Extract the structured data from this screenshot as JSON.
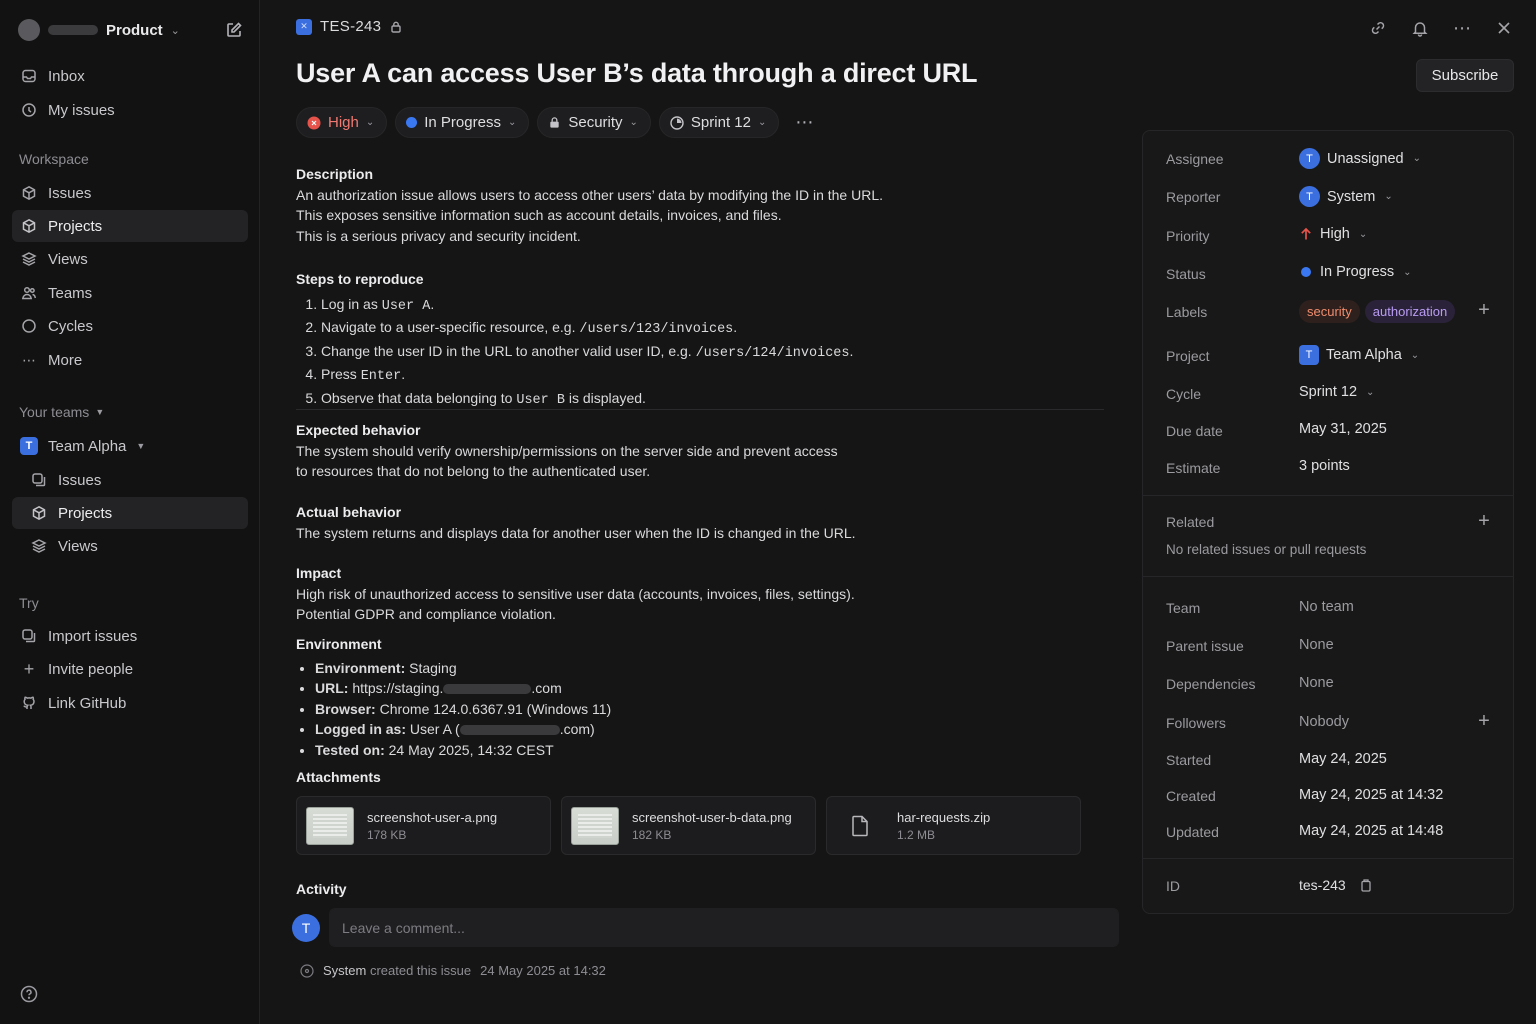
{
  "sidebar": {
    "workspace_name": "Product",
    "nav": [
      {
        "label": "Inbox"
      },
      {
        "label": "My issues"
      }
    ],
    "workspace_label": "Workspace",
    "workspace_items": [
      {
        "label": "Issues"
      },
      {
        "label": "Projects"
      },
      {
        "label": "Views"
      },
      {
        "label": "Teams"
      },
      {
        "label": "Cycles"
      },
      {
        "label": "More"
      }
    ],
    "your_teams_label": "Your teams",
    "team": {
      "badge": "T",
      "name": "Team Alpha"
    },
    "team_items": [
      {
        "label": "Issues"
      },
      {
        "label": "Projects"
      },
      {
        "label": "Views"
      }
    ],
    "try_label": "Try",
    "try_items": [
      {
        "label": "Import issues"
      },
      {
        "label": "Invite people"
      },
      {
        "label": "Link GitHub"
      }
    ]
  },
  "issue": {
    "id": "TES-243",
    "title": "User A can access User B’s data through a direct URL",
    "subscribe_label": "Subscribe",
    "pills": {
      "priority": "High",
      "status": "In Progress",
      "label": "Security",
      "sprint": "Sprint 12"
    },
    "description": {
      "heading": "Description",
      "lines": [
        "An authorization issue allows users to access other users’ data by modifying the ID in the URL.",
        "This exposes sensitive information such as account details, invoices, and files.",
        "This is a serious privacy and security incident."
      ]
    },
    "steps": {
      "heading": "Steps to reproduce",
      "items": [
        {
          "pre": "Log in as ",
          "code": "User A",
          "post": "."
        },
        {
          "pre": "Navigate to a user-specific resource, e.g. ",
          "code": "/users/123/invoices",
          "post": "."
        },
        {
          "pre": "Change the user ID in the URL to another valid user ID, e.g. ",
          "code": "/users/124/invoices",
          "post": "."
        },
        {
          "pre": "Press ",
          "code": "Enter",
          "post": "."
        },
        {
          "pre": "Observe that data belonging to ",
          "code": "User B",
          "post": " is displayed."
        }
      ]
    },
    "expected": {
      "heading": "Expected behavior",
      "lines": [
        "The system should verify ownership/permissions on the server side and prevent access",
        "to resources that do not belong to the authenticated user."
      ]
    },
    "actual": {
      "heading": "Actual behavior",
      "lines": [
        "The system returns and displays data for another user when the ID is changed in the URL."
      ]
    },
    "impact": {
      "heading": "Impact",
      "lines": [
        "High risk of unauthorized access to sensitive user data (accounts, invoices, files, settings).",
        "Potential GDPR and compliance violation."
      ]
    },
    "environment": {
      "heading": "Environment",
      "items": [
        {
          "key": "Environment:",
          "value": " Staging",
          "tail": ""
        },
        {
          "key": "URL:",
          "value": " https://staging.",
          "tail": ".com"
        },
        {
          "key": "Browser:",
          "value": " Chrome 124.0.6367.91 (Windows 11)",
          "tail": ""
        },
        {
          "key": "Logged in as:",
          "value": " User A (",
          "tail": ".com)"
        },
        {
          "key": "Tested on:",
          "value": " 24 May 2025, 14:32 CEST",
          "tail": ""
        }
      ]
    },
    "attachments": {
      "heading": "Attachments",
      "files": [
        {
          "name": "screenshot-user-a.png",
          "size": "178 KB"
        },
        {
          "name": "screenshot-user-b-data.png",
          "size": "182 KB"
        },
        {
          "name": "har-requests.zip",
          "size": "1.2 MB"
        }
      ]
    },
    "activity": {
      "heading": "Activity",
      "avatar": "T",
      "comment_placeholder": "Leave a comment...",
      "event_actor": "System",
      "event_text": " created this issue",
      "event_time": "24 May 2025 at 14:32"
    }
  },
  "panel": {
    "assignee": {
      "label": "Assignee",
      "avatar": "T",
      "value": "Unassigned"
    },
    "reporter": {
      "label": "Reporter",
      "avatar": "T",
      "value": "System"
    },
    "priority": {
      "label": "Priority",
      "value": "High"
    },
    "status": {
      "label": "Status",
      "value": "In Progress"
    },
    "labels": {
      "label": "Labels",
      "items": [
        "security",
        "authorization"
      ]
    },
    "project": {
      "label": "Project",
      "badge": "T",
      "value": "Team Alpha"
    },
    "cycle": {
      "label": "Cycle",
      "value": "Sprint 12"
    },
    "due_date": {
      "label": "Due date",
      "value": "May 31, 2025"
    },
    "estimate": {
      "label": "Estimate",
      "value": "3 points"
    },
    "related": {
      "label": "Related",
      "empty": "No related issues or pull requests"
    },
    "team": {
      "label": "Team",
      "value": "No team"
    },
    "parent": {
      "label": "Parent issue",
      "value": "None"
    },
    "dependencies": {
      "label": "Dependencies",
      "value": "None"
    },
    "followers": {
      "label": "Followers",
      "value": "Nobody"
    },
    "started": {
      "label": "Started",
      "value": "May 24, 2025"
    },
    "created": {
      "label": "Created",
      "value": "May 24, 2025 at 14:32"
    },
    "updated": {
      "label": "Updated",
      "value": "May 24, 2025 at 14:48"
    },
    "id": {
      "label": "ID",
      "value": "tes-243"
    }
  },
  "colors": {
    "accent": "#3b6fe0",
    "priority_high": "#e5534b",
    "status_in_progress": "#3a78f2",
    "label_security": "#f08d6e",
    "label_authorization": "#b99cf3"
  }
}
